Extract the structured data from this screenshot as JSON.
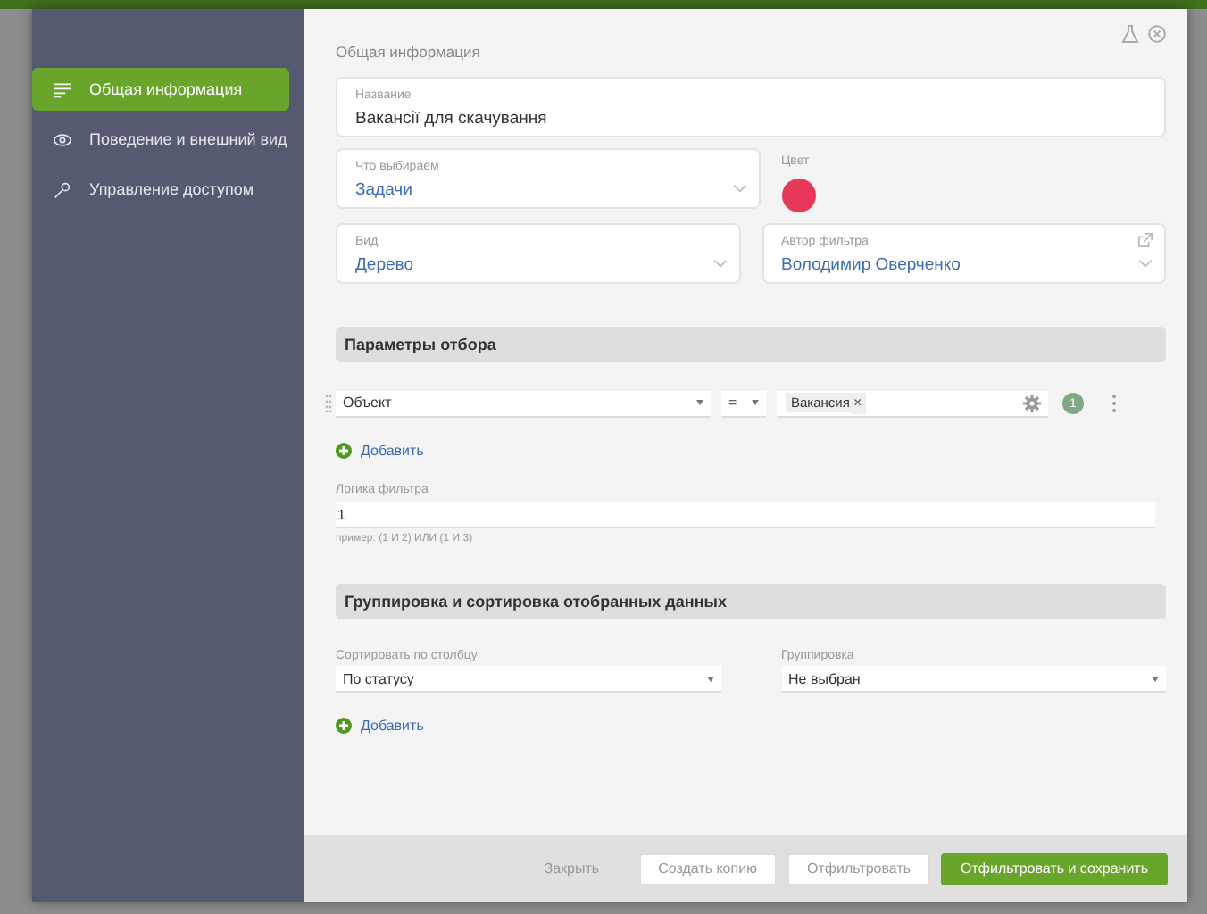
{
  "sidebar": {
    "items": [
      {
        "label": "Общая информация",
        "selected": true
      },
      {
        "label": "Поведение и внешний вид",
        "selected": false
      },
      {
        "label": "Управление доступом",
        "selected": false
      }
    ]
  },
  "section_title": "Общая информация",
  "name_field": {
    "label": "Название",
    "value": "Вакансії для скачування"
  },
  "what_field": {
    "label": "Что выбираем",
    "value": "Задачи"
  },
  "color_field": {
    "label": "Цвет",
    "color": "#e8385a"
  },
  "view_field": {
    "label": "Вид",
    "value": "Дерево"
  },
  "author_field": {
    "label": "Автор фильтра",
    "value": "Володимир Оверченко"
  },
  "filter_section": {
    "title": "Параметры отбора",
    "condition": {
      "field": "Объект",
      "operator": "=",
      "tag": "Вакансия",
      "tag_remove": "×",
      "number": "1"
    },
    "add": "Добавить",
    "logic": {
      "label": "Логика фильтра",
      "value": "1",
      "hint": "пример: (1 И 2) ИЛИ (1 И 3)"
    }
  },
  "group_section": {
    "title": "Группировка и сортировка отобранных данных",
    "sort": {
      "label": "Сортировать по столбцу",
      "value": "По статусу"
    },
    "group": {
      "label": "Группировка",
      "value": "Не выбран"
    },
    "add": "Добавить"
  },
  "footer": {
    "buttons": [
      {
        "label": "Закрыть",
        "kind": "link"
      },
      {
        "label": "Создать копию",
        "kind": "secondary"
      },
      {
        "label": "Отфильтровать",
        "kind": "secondary"
      },
      {
        "label": "Отфильтровать и сохранить",
        "kind": "primary"
      }
    ]
  }
}
